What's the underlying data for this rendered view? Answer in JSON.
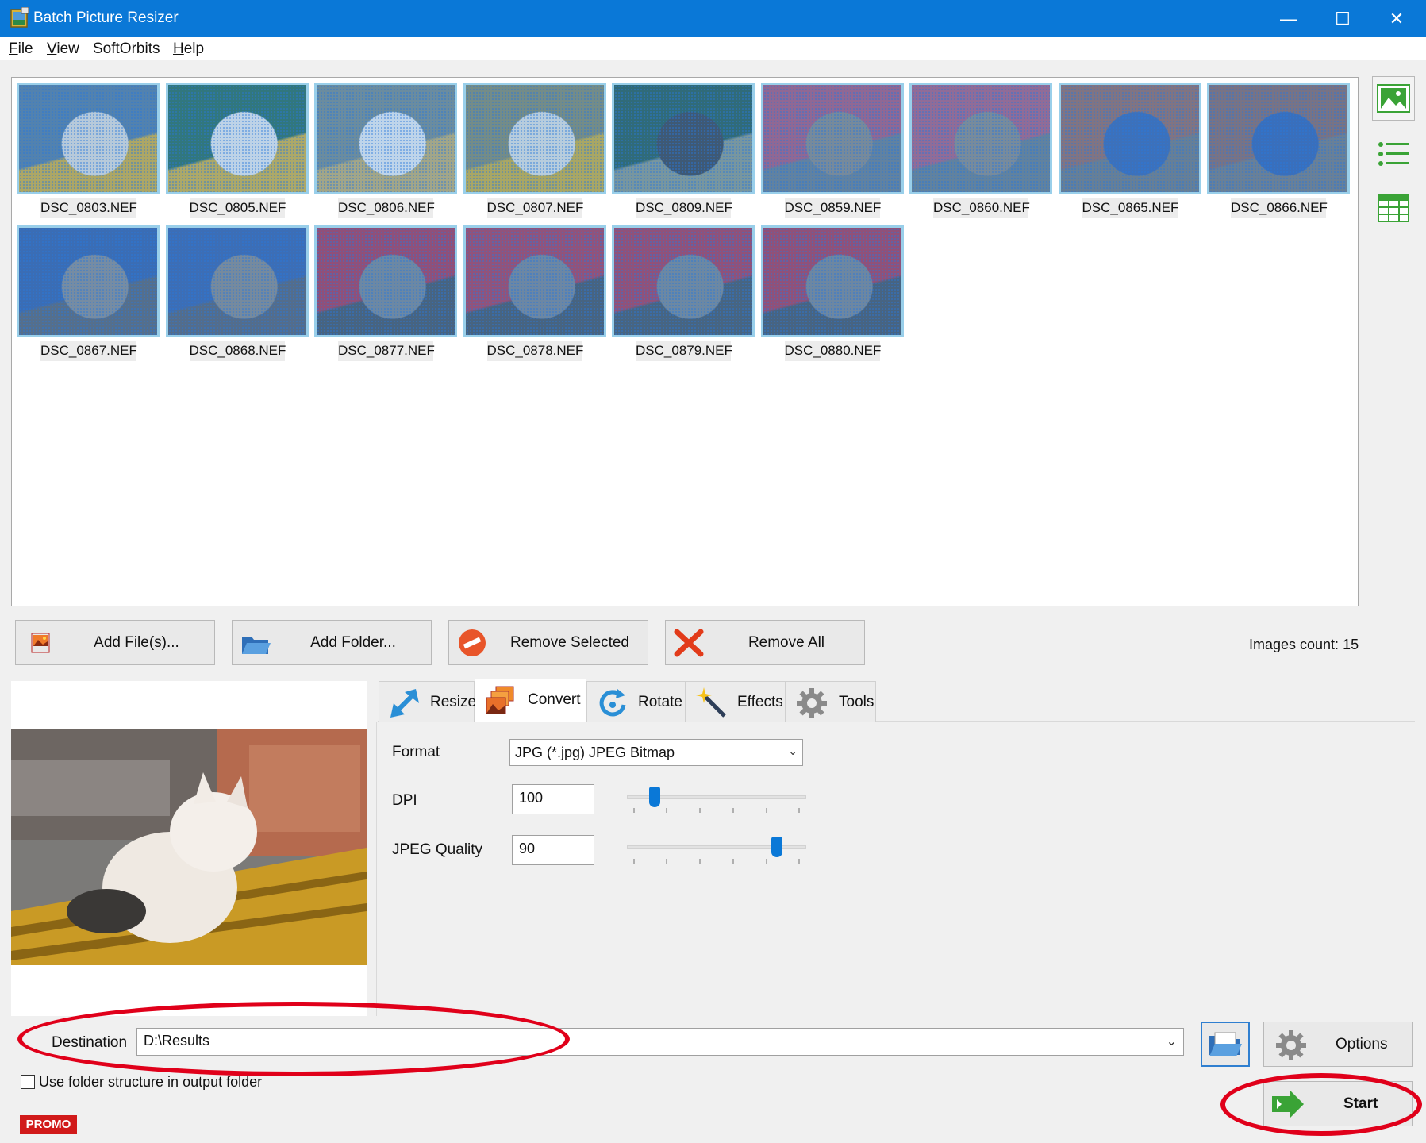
{
  "window": {
    "title": "Batch Picture Resizer",
    "controls": {
      "minimize": "—",
      "maximize": "☐",
      "close": "✕"
    }
  },
  "menu": [
    {
      "label": "File",
      "mnemonic": "F",
      "rest": "ile"
    },
    {
      "label": "View",
      "mnemonic": "V",
      "rest": "iew"
    },
    {
      "label": "SoftOrbits",
      "mnemonic": "",
      "rest": "SoftOrbits"
    },
    {
      "label": "Help",
      "mnemonic": "H",
      "rest": "elp"
    }
  ],
  "gallery": {
    "images": [
      {
        "name": "DSC_0803.NEF",
        "palette": [
          "#5a7fa0",
          "#e6e2dc",
          "#d9b23a"
        ]
      },
      {
        "name": "DSC_0805.NEF",
        "palette": [
          "#2d6f5c",
          "#f0efee",
          "#d8b53d"
        ]
      },
      {
        "name": "DSC_0806.NEF",
        "palette": [
          "#7d8c8a",
          "#f2f2f2",
          "#c9b16a"
        ]
      },
      {
        "name": "DSC_0807.NEF",
        "palette": [
          "#8a8c6a",
          "#e8e6e0",
          "#d3b238"
        ]
      },
      {
        "name": "DSC_0809.NEF",
        "palette": [
          "#2c5f55",
          "#3f4650",
          "#8f9a8a"
        ]
      },
      {
        "name": "DSC_0859.NEF",
        "palette": [
          "#b05a7a",
          "#8e8a84",
          "#6f7f8c"
        ]
      },
      {
        "name": "DSC_0860.NEF",
        "palette": [
          "#b2607e",
          "#8f8b85",
          "#6f7e8a"
        ]
      },
      {
        "name": "DSC_0865.NEF",
        "palette": [
          "#9b6b62",
          "#3c67b0",
          "#777a7e"
        ]
      },
      {
        "name": "DSC_0866.NEF",
        "palette": [
          "#8f6a66",
          "#3865b2",
          "#7a7c80"
        ]
      },
      {
        "name": "DSC_0867.NEF",
        "palette": [
          "#3a62a8",
          "#8d8d8f",
          "#5f6470"
        ]
      },
      {
        "name": "DSC_0868.NEF",
        "palette": [
          "#3c63aa",
          "#8c8a88",
          "#5c6270"
        ]
      },
      {
        "name": "DSC_0877.NEF",
        "palette": [
          "#b03a55",
          "#7e8790",
          "#4c5560"
        ]
      },
      {
        "name": "DSC_0878.NEF",
        "palette": [
          "#b23d58",
          "#7f8690",
          "#4b5560"
        ]
      },
      {
        "name": "DSC_0879.NEF",
        "palette": [
          "#b13c56",
          "#7f878f",
          "#4c5662"
        ]
      },
      {
        "name": "DSC_0880.NEF",
        "palette": [
          "#b03b55",
          "#80868e",
          "#4c5561"
        ]
      }
    ]
  },
  "side_views": [
    {
      "icon": "thumbnail-view-icon",
      "active": true
    },
    {
      "icon": "list-view-icon",
      "active": false
    },
    {
      "icon": "table-view-icon",
      "active": false
    }
  ],
  "actions": {
    "add_files": {
      "label": "Add File(s)...",
      "icon": "add-image-icon"
    },
    "add_folder": {
      "label": "Add Folder...",
      "icon": "folder-icon"
    },
    "remove_selected": {
      "label": "Remove Selected",
      "icon": "no-entry-icon"
    },
    "remove_all": {
      "label": "Remove All",
      "icon": "red-x-icon"
    },
    "images_count": "Images count: 15"
  },
  "tabs": [
    {
      "label": "Resize",
      "icon": "resize-arrow-icon",
      "active": false
    },
    {
      "label": "Convert",
      "icon": "convert-images-icon",
      "active": true
    },
    {
      "label": "Rotate",
      "icon": "rotate-icon",
      "active": false
    },
    {
      "label": "Effects",
      "icon": "magic-wand-icon",
      "active": false
    },
    {
      "label": "Tools",
      "icon": "gear-icon",
      "active": false
    }
  ],
  "convert": {
    "format_label": "Format",
    "format_value": "JPG (*.jpg) JPEG Bitmap",
    "dpi_label": "DPI",
    "dpi_value": "100",
    "dpi_slider_fraction": 0.13,
    "quality_label": "JPEG Quality",
    "quality_value": "90",
    "quality_slider_fraction": 0.86
  },
  "destination": {
    "label": "Destination",
    "value": "D:\\Results",
    "use_folder_structure_label": "Use folder structure in output folder",
    "use_folder_structure_checked": false
  },
  "buttons": {
    "options": "Options",
    "start": "Start"
  },
  "promo": "PROMO",
  "colors": {
    "titlebar": "#0a78d7",
    "selection": "#99cfea",
    "annotation": "#e0001a",
    "accent": "#0a78d7"
  }
}
